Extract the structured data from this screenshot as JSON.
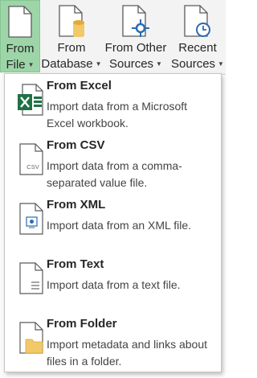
{
  "ribbon": {
    "from_file": {
      "line1": "From",
      "line2": "File"
    },
    "from_database": {
      "line1": "From",
      "line2": "Database"
    },
    "from_other_sources": {
      "line1": "From Other",
      "line2": "Sources"
    },
    "recent_sources": {
      "line1": "Recent",
      "line2": "Sources"
    }
  },
  "menu": {
    "items": [
      {
        "title": "From Excel",
        "description": "Import data from a Microsoft Excel workbook.",
        "icon": "excel-file-icon"
      },
      {
        "title": "From CSV",
        "description": "Import data from a comma-separated value file.",
        "icon": "csv-file-icon",
        "icon_text": "CSV"
      },
      {
        "title": "From XML",
        "description": "Import data from an XML file.",
        "icon": "xml-file-icon"
      },
      {
        "title": "From Text",
        "description": "Import data from a text file.",
        "icon": "text-file-icon"
      },
      {
        "title": "From Folder",
        "description": "Import metadata and links about files in a folder.",
        "icon": "folder-file-icon"
      }
    ]
  },
  "colors": {
    "active_button": "#9dd5a8",
    "excel_green": "#1f7244",
    "folder_yellow": "#f2c96a",
    "accent_blue": "#2b6cb0"
  }
}
